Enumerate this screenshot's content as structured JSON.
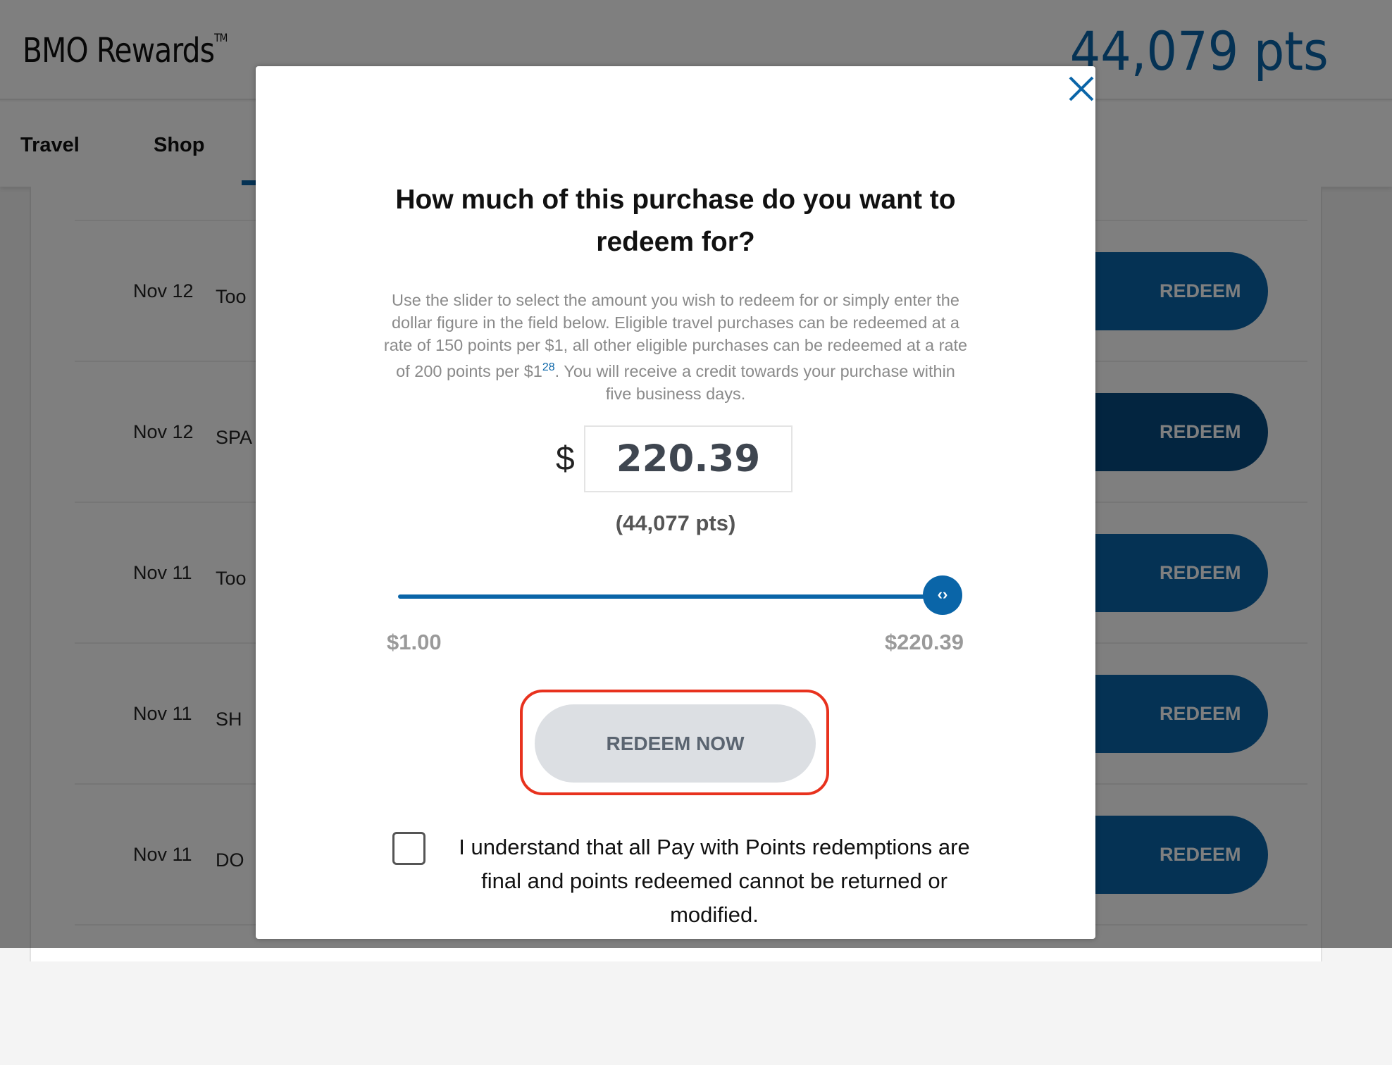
{
  "header": {
    "logo": "BMO Rewards",
    "trademark": "TM",
    "points": "44,079 pts"
  },
  "nav": {
    "tabs": [
      {
        "label": "Travel"
      },
      {
        "label": "Shop"
      }
    ]
  },
  "transactions": [
    {
      "date": "Nov 12",
      "merchant": "Too",
      "action": "REDEEM"
    },
    {
      "date": "Nov 12",
      "merchant": "SPA",
      "action": "REDEEM"
    },
    {
      "date": "Nov 11",
      "merchant": "Too",
      "action": "REDEEM"
    },
    {
      "date": "Nov 11",
      "merchant": "SH",
      "action": "REDEEM"
    },
    {
      "date": "Nov 11",
      "merchant": "DO",
      "action": "REDEEM"
    }
  ],
  "modal": {
    "title": "How much of this purchase do you want to redeem for?",
    "description_pre": "Use the slider to select the amount you wish to redeem for or simply enter the dollar figure in the field below. Eligible travel purchases can be redeemed at a rate of 150 points per $1, all other eligible purchases can be redeemed at a rate of 200 points per $1",
    "footnote": "28",
    "description_post": ". You will receive a credit towards your purchase within five business days.",
    "currency": "$",
    "amount": "220.39",
    "points_equivalent": "(44,077 pts)",
    "slider": {
      "min_label": "$1.00",
      "max_label": "$220.39",
      "min": 1.0,
      "max": 220.39,
      "value": 220.39,
      "thumb_glyph": "‹›"
    },
    "redeem_button": "REDEEM NOW",
    "checkbox_label": "I understand that all Pay with Points redemptions are final and points redeemed cannot be returned or modified.",
    "checkbox_checked": false
  },
  "colors": {
    "brand": "#0a65a8",
    "highlight": "#e8321e",
    "button_disabled": "#dcdfe3"
  }
}
